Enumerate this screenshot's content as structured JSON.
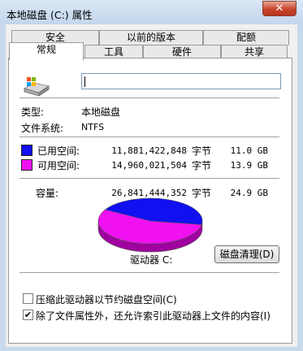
{
  "window": {
    "title": "本地磁盘 (C:) 属性",
    "close_glyph": "✕"
  },
  "tabs_back": [
    "安全",
    "以前的版本",
    "配额"
  ],
  "tabs_front": [
    "常规",
    "工具",
    "硬件",
    "共享"
  ],
  "general": {
    "name_value": "",
    "type_label": "类型:",
    "type_value": "本地磁盘",
    "fs_label": "文件系统:",
    "fs_value": "NTFS",
    "used": {
      "label": "已用空间:",
      "bytes": "11,881,422,848",
      "unit": "字节",
      "size": "11.0 GB",
      "color": "#1010f0"
    },
    "free": {
      "label": "可用空间:",
      "bytes": "14,960,021,504",
      "unit": "字节",
      "size": "13.9 GB",
      "color": "#f010f0"
    },
    "capacity": {
      "label": "容量:",
      "bytes": "26,841,444,352",
      "unit": "字节",
      "size": "24.9 GB"
    },
    "drive_label": "驱动器 C:",
    "cleanup_button": "磁盘清理(D)",
    "compress_checkbox": {
      "label": "压缩此驱动器以节约磁盘空间(C)",
      "checked": false
    },
    "index_checkbox": {
      "label": "除了文件属性外，还允许索引此驱动器上文件的内容(I)",
      "checked": true
    }
  },
  "icons": {
    "drive": "drive-icon",
    "close": "close-icon",
    "check": "check-icon"
  },
  "colors": {
    "used": "#1010f0",
    "free": "#f010f0"
  }
}
